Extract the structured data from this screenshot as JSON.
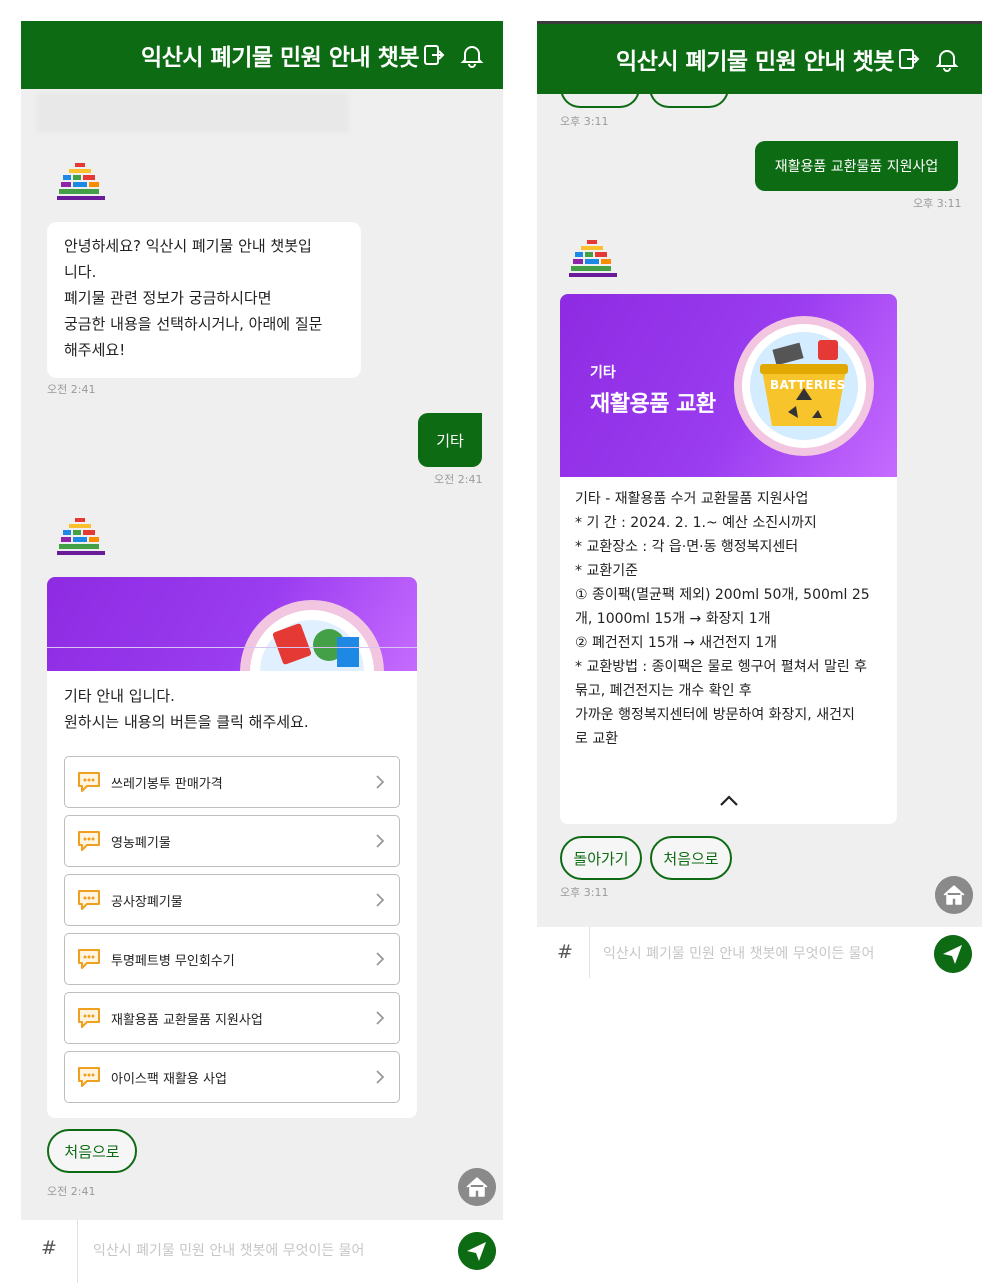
{
  "panel_left": {
    "header": {
      "title": "익산시 폐기물 민원 안내 챗봇",
      "exit_icon": "exit-icon",
      "bell_icon": "bell-icon"
    },
    "greeting": {
      "lines": [
        "안녕하세요? 익산시 폐기물 안내 챗봇입",
        "니다.",
        "폐기물 관련 정보가 궁금하시다면",
        "궁금한 내용을 선택하시거나, 아래에 질문",
        "해주세요!"
      ],
      "time": "오전 2:41"
    },
    "user_message": {
      "text": "기타",
      "time": "오전 2:41"
    },
    "menu_card": {
      "intro_lines": [
        "기타 안내 입니다.",
        "원하시는 내용의 버튼을 클릭 해주세요."
      ],
      "options": [
        {
          "label": "쓰레기봉투 판매가격",
          "icon": "chat-bubble-icon"
        },
        {
          "label": "영농폐기물",
          "icon": "chat-bubble-icon"
        },
        {
          "label": "공사장폐기물",
          "icon": "chat-bubble-icon"
        },
        {
          "label": "투명페트병 무인회수기",
          "icon": "chat-bubble-icon"
        },
        {
          "label": "재활용품 교환물품 지원사업",
          "icon": "chat-bubble-icon"
        },
        {
          "label": "아이스팩 재활용 사업",
          "icon": "chat-bubble-icon"
        }
      ]
    },
    "home_pill": {
      "label": "처음으로"
    },
    "reply_time": "오전 2:41",
    "input": {
      "hash": "#",
      "placeholder": "익산시 폐기물 민원 안내 챗봇에 무엇이든 물어"
    }
  },
  "panel_right": {
    "header": {
      "title": "익산시 폐기물 민원 안내 챗봇",
      "exit_icon": "exit-icon",
      "bell_icon": "bell-icon"
    },
    "top_time": "오후 3:11",
    "user_message": {
      "text": "재활용품 교환물품 지원사업",
      "time": "오후 3:11"
    },
    "info_card": {
      "banner_subtitle": "기타",
      "banner_title": "재활용품 교환",
      "banner_badge": "BATTERIES",
      "detail_lines": [
        "기타 - 재활용품 수거 교환물품 지원사업",
        "* 기 간 : 2024. 2. 1.~ 예산 소진시까지",
        "* 교환장소 : 각 읍·면·동 행정복지센터",
        "* 교환기준",
        "① 종이팩(멸균팩 제외) 200ml 50개, 500ml 25",
        "개, 1000ml 15개 → 화장지 1개",
        "② 폐건전지 15개 → 새건전지 1개",
        "* 교환방법 : 종이팩은 물로 헹구어 펼쳐서 말린 후",
        "묶고, 폐건전지는 개수 확인 후",
        "가까운 행정복지센터에 방문하여 화장지, 새건지",
        "로 교환"
      ],
      "collapse_icon": "chevron-up-icon"
    },
    "buttons": {
      "back_label": "돌아가기",
      "home_label": "처음으로"
    },
    "reply_time": "오후 3:11",
    "input": {
      "hash": "#",
      "placeholder": "익산시 폐기물 민원 안내 챗봇에 무엇이든 물어"
    }
  },
  "colors": {
    "brand_green": "#0d6b13",
    "banner_purple": "#9a3cf0",
    "panel_bg": "#efefef"
  }
}
